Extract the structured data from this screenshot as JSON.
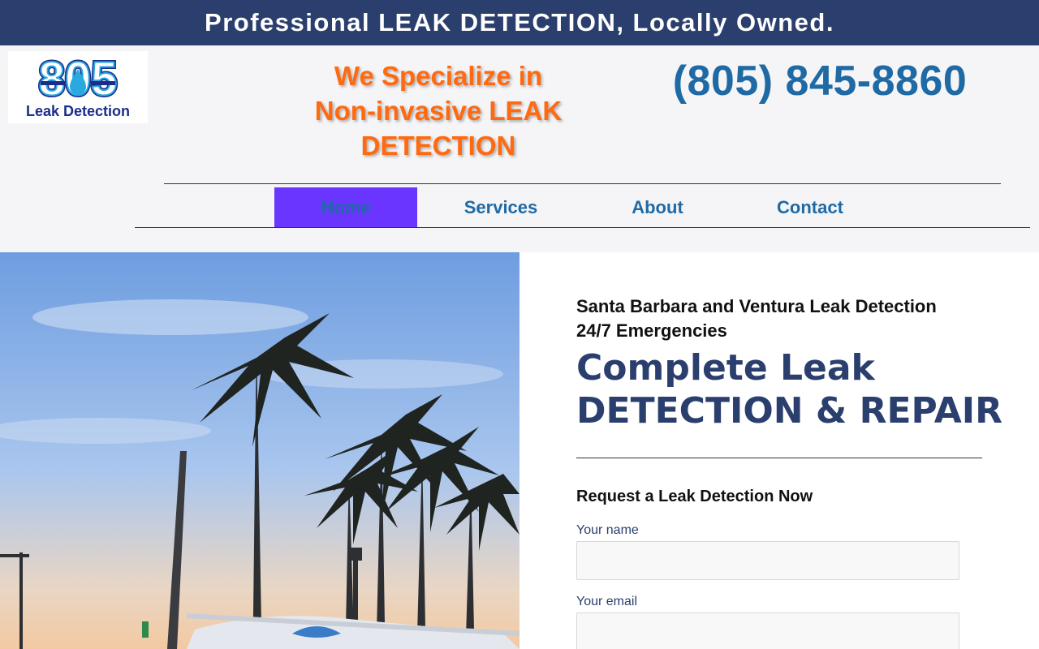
{
  "topbar": {
    "text": "Professional LEAK DETECTION, Locally Owned."
  },
  "logo": {
    "number_text": "805",
    "caption": "Leak Detection"
  },
  "tagline": {
    "text": "We Specialize in Non-invasive LEAK DETECTION"
  },
  "phone": {
    "text": "(805) 845-8860"
  },
  "nav": {
    "items": [
      {
        "label": "Home",
        "active": true
      },
      {
        "label": "Services",
        "active": false
      },
      {
        "label": "About",
        "active": false
      },
      {
        "label": "Contact",
        "active": false
      }
    ]
  },
  "main": {
    "subhead_line1": "Santa Barbara and Ventura Leak Detection",
    "subhead_line2": "24/7 Emergencies",
    "heading": "Complete Leak DETECTION & REPAIR",
    "form": {
      "title": "Request a Leak Detection Now",
      "name_label": "Your name",
      "name_value": "",
      "email_label": "Your email",
      "email_value": ""
    }
  },
  "colors": {
    "brand_navy": "#2b3f6e",
    "accent_orange": "#ff6a10",
    "link_blue": "#1f6aa5",
    "nav_active": "#6a35ff"
  }
}
